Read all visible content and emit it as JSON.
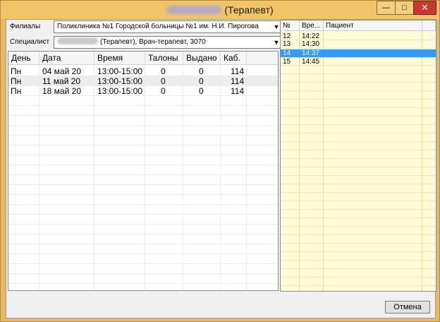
{
  "window": {
    "title_suffix": "(Терапевт)",
    "min_glyph": "—",
    "max_glyph": "□",
    "close_glyph": "✕",
    "close_color": "#c9392b"
  },
  "filters": {
    "branch_label": "Филиалы",
    "branch_value": "Поликлиника №1 Городской больницы №1 им. Н.И. Пирогова",
    "specialist_label": "Специалист",
    "specialist_value": "(Терапевт), Врач-терапевт, 3070"
  },
  "schedule": {
    "columns": [
      "День",
      "Дата",
      "Время",
      "Талоны",
      "Выдано",
      "Каб."
    ],
    "rows": [
      [
        "Пн",
        "04 май 20",
        "13:00-15:00",
        "0",
        "0",
        "114"
      ],
      [
        "Пн",
        "11 май 20",
        "13:00-15:00",
        "0",
        "0",
        "114"
      ],
      [
        "Пн",
        "18 май 20",
        "13:00-15:00",
        "0",
        "0",
        "114"
      ]
    ]
  },
  "slots": {
    "columns": [
      "№",
      "Вре...",
      "Пациент"
    ],
    "rows": [
      [
        "12",
        "14:22",
        ""
      ],
      [
        "13",
        "14:30",
        ""
      ],
      [
        "14",
        "14:37",
        ""
      ],
      [
        "15",
        "14:45",
        ""
      ]
    ],
    "selected_index": 2,
    "selection_color": "#3399ff"
  },
  "actions": {
    "cancel_label": "Отмена"
  }
}
